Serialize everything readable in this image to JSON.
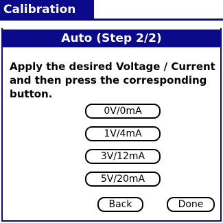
{
  "app": {
    "title": "Calibration"
  },
  "dialog": {
    "header": "Auto (Step 2/2)",
    "instruction": "Apply the desired Voltage / Current and then press the corresponding button.",
    "level_buttons": [
      "0V/0mA",
      "1V/4mA",
      "3V/12mA",
      "5V/20mA"
    ],
    "back_label": "Back",
    "done_label": "Done"
  },
  "colors": {
    "accent": "#0a0a8a",
    "background": "#ffffff",
    "text": "#000000"
  }
}
